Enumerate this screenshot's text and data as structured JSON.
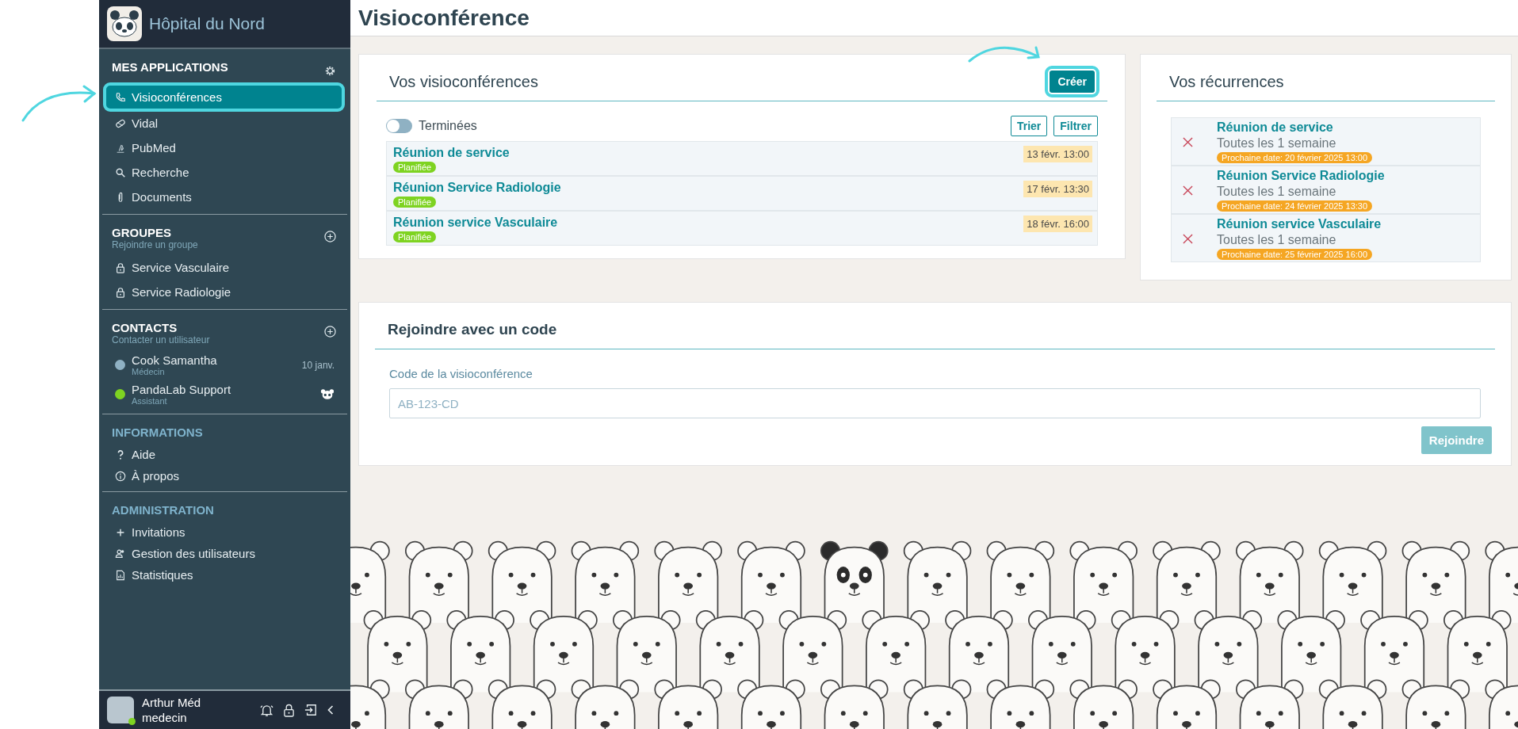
{
  "sidebar": {
    "title": "Hôpital du Nord",
    "sections": [
      {
        "kind": "apps",
        "title": "MES APPLICATIONS",
        "items": [
          {
            "label": "Visioconférences",
            "selected": true
          },
          {
            "label": "Vidal",
            "selected": false
          },
          {
            "label": "PubMed",
            "selected": false
          },
          {
            "label": "Recherche",
            "selected": false
          },
          {
            "label": "Documents",
            "selected": false
          }
        ]
      },
      {
        "kind": "groups",
        "title": "GROUPES",
        "subtitle": "Rejoindre un groupe",
        "items": [
          {
            "label": "Service Vasculaire",
            "selected": false
          },
          {
            "label": "Service Radiologie",
            "selected": false
          }
        ]
      },
      {
        "kind": "contacts",
        "title": "CONTACTS",
        "subtitle": "Contacter un utilisateur",
        "items": [
          {
            "label": "Cook Samantha",
            "role": "Médecin",
            "date": "10 janv.",
            "color": "#8fb1c3",
            "selected": false
          },
          {
            "label": "PandaLab Support",
            "role": "Assistant",
            "color": "#7ed321",
            "selected": false
          }
        ]
      },
      {
        "kind": "info",
        "title": "INFORMATIONS",
        "items": [
          {
            "label": "Aide",
            "selected": false
          },
          {
            "label": "À propos",
            "selected": false
          }
        ]
      },
      {
        "kind": "admin",
        "title": "ADMINISTRATION",
        "items": [
          {
            "label": "Invitations",
            "selected": false
          },
          {
            "label": "Gestion des utilisateurs",
            "selected": false
          },
          {
            "label": "Statistiques",
            "selected": false
          }
        ]
      }
    ],
    "user": {
      "name": "Arthur Méd",
      "role": "medecin"
    }
  },
  "page_title": "Visioconférence",
  "meetings": {
    "title": "Vos visioconférences",
    "create_button": {
      "label": "Créer",
      "highlighted": true
    },
    "toggle": {
      "label": "Terminées",
      "on": false
    },
    "buttons": [
      "Trier",
      "Filtrer"
    ],
    "rows": [
      {
        "title": "Réunion de service",
        "status": "Planifiée",
        "date": "13 févr. 13:00"
      },
      {
        "title": "Réunion Service Radiologie",
        "status": "Planifiée",
        "date": "17 févr. 13:30"
      },
      {
        "title": "Réunion service Vasculaire",
        "status": "Planifiée",
        "date": "18 févr. 16:00"
      }
    ]
  },
  "recurrences": {
    "title": "Vos récurrences",
    "rows": [
      {
        "title": "Réunion de service",
        "frequency": "Toutes les 1 semaine",
        "next": "Prochaine date: 20 février 2025 13:00"
      },
      {
        "title": "Réunion Service Radiologie",
        "frequency": "Toutes les 1 semaine",
        "next": "Prochaine date: 24 février 2025 13:30"
      },
      {
        "title": "Réunion service Vasculaire",
        "frequency": "Toutes les 1 semaine",
        "next": "Prochaine date: 25 février 2025 16:00"
      }
    ]
  },
  "join": {
    "title": "Rejoindre avec un code",
    "label": "Code de la visioconférence",
    "placeholder": "AB-123-CD",
    "button": {
      "label": "Rejoindre",
      "disabled": true
    }
  }
}
